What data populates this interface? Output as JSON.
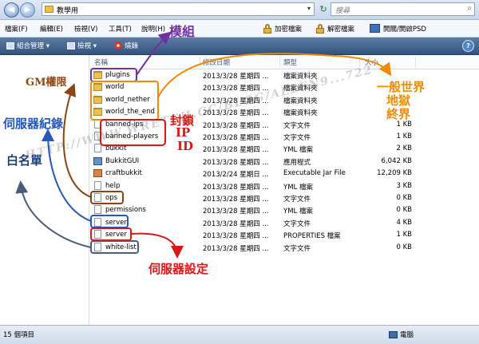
{
  "address": {
    "path": "教學用",
    "arrow": "▸",
    "search_placeholder": "搜尋"
  },
  "menu": {
    "items": [
      "檔案(F)",
      "編輯(E)",
      "檢視(V)",
      "工具(T)",
      "說明(H)"
    ],
    "encrypt": "加密檔案",
    "decrypt": "解密檔案",
    "psd": "開關/開啟PSD"
  },
  "toolbar": {
    "organize": "組合管理 ▾",
    "view": "檢視 ▾",
    "burn": "燒錄",
    "help": "?"
  },
  "columns": {
    "name": "名稱",
    "date": "修改日期",
    "type": "類型",
    "size": "大小"
  },
  "files": [
    {
      "name": "plugins",
      "date": "2013/3/28 星期四 ...",
      "type": "檔案資料夾",
      "size": "",
      "icon": "folder-icon"
    },
    {
      "name": "world",
      "date": "2013/3/28 星期四 ...",
      "type": "檔案資料夾",
      "size": "",
      "icon": "folder-icon"
    },
    {
      "name": "world_nether",
      "date": "2013/3/28 星期四 ...",
      "type": "檔案資料夾",
      "size": "",
      "icon": "folder-icon"
    },
    {
      "name": "world_the_end",
      "date": "2013/3/28 星期四 ...",
      "type": "檔案資料夾",
      "size": "",
      "icon": "folder-icon"
    },
    {
      "name": "banned-ips",
      "date": "2013/3/28 星期四 ...",
      "type": "文字文件",
      "size": "1 KB",
      "icon": "text-file-icon"
    },
    {
      "name": "banned-players",
      "date": "2013/3/28 星期四 ...",
      "type": "文字文件",
      "size": "1 KB",
      "icon": "text-file-icon"
    },
    {
      "name": "bukkit",
      "date": "2013/3/28 星期四 ...",
      "type": "YML 檔案",
      "size": "2 KB",
      "icon": "yml-file-icon"
    },
    {
      "name": "BukkitGUI",
      "date": "2013/3/28 星期四 ...",
      "type": "應用程式",
      "size": "6,042 KB",
      "icon": "application-icon"
    },
    {
      "name": "craftbukkit",
      "date": "2013/2/24 星期日 ...",
      "type": "Executable Jar File",
      "size": "12,209 KB",
      "icon": "jar-file-icon"
    },
    {
      "name": "help",
      "date": "2013/3/28 星期四 ...",
      "type": "YML 檔案",
      "size": "3 KB",
      "icon": "yml-file-icon"
    },
    {
      "name": "ops",
      "date": "2013/3/28 星期四 ...",
      "type": "文字文件",
      "size": "0 KB",
      "icon": "text-file-icon"
    },
    {
      "name": "permissions",
      "date": "2013/3/28 星期四 ...",
      "type": "YML 檔案",
      "size": "0 KB",
      "icon": "yml-file-icon"
    },
    {
      "name": "server",
      "date": "2013/3/28 星期四 ...",
      "type": "文字文件",
      "size": "4 KB",
      "icon": "text-file-icon"
    },
    {
      "name": "server",
      "date": "2013/3/28 星期四 ...",
      "type": "PROPERTIES 檔案",
      "size": "1 KB",
      "icon": "properties-file-icon"
    },
    {
      "name": "white-list",
      "date": "2013/3/28 星期四 ...",
      "type": "文字文件",
      "size": "0 KB",
      "icon": "text-file-icon"
    }
  ],
  "status": {
    "count": "15 個項目",
    "computer": "電腦"
  },
  "annotations": {
    "modules": "模組",
    "gm": "GM權限",
    "server_log": "伺服器紀錄",
    "whitelist": "白名單",
    "ban_line1": "封鎖",
    "ban_line2": "IP",
    "ban_line3": "ID",
    "worlds_line1": "一般世界",
    "worlds_line2": "地獄",
    "worlds_line3": "終界",
    "server_settings": "伺服器設定",
    "watermark": "HTTP://WWW.WRETCH.CC/BLOG/ALLEN9...722",
    "color_purple": "#7030a0",
    "color_orange": "#f08a00",
    "color_red": "#d81818",
    "color_blue": "#2457b8",
    "color_brown": "#8b4513"
  }
}
